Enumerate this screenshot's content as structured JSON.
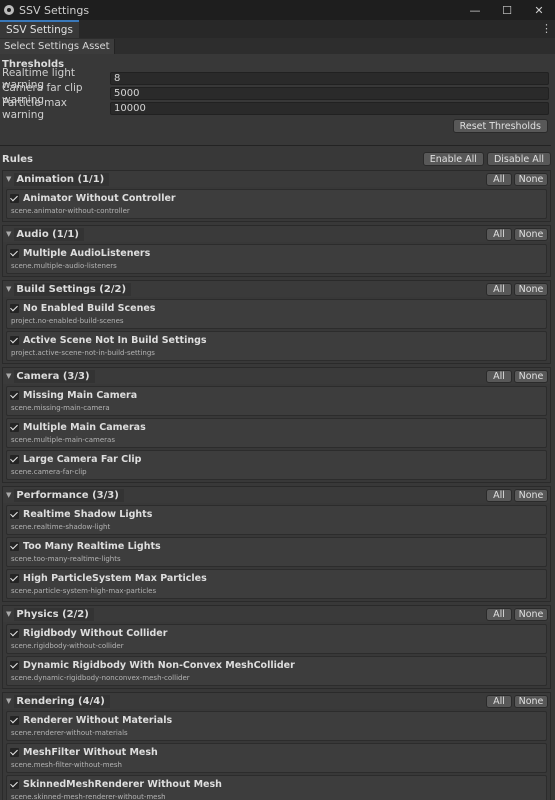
{
  "window": {
    "title": "SSV Settings",
    "minimize": "—",
    "maximize": "☐",
    "close": "✕"
  },
  "tab": {
    "label": "SSV Settings",
    "menu": "⋮"
  },
  "toolbar": {
    "select_label": "Select Settings Asset"
  },
  "thresholds": {
    "title": "Thresholds",
    "fields": [
      {
        "label": "Realtime light warning",
        "value": "8"
      },
      {
        "label": "Camera far clip warning",
        "value": "5000"
      },
      {
        "label": "Particle max warning",
        "value": "10000"
      }
    ],
    "reset_label": "Reset Thresholds"
  },
  "rules": {
    "title": "Rules",
    "enable_all": "Enable All",
    "disable_all": "Disable All",
    "all_label": "All",
    "none_label": "None",
    "groups": [
      {
        "title": "Animation (1/1)",
        "items": [
          {
            "name": "Animator Without Controller",
            "id": "scene.animator-without-controller"
          }
        ]
      },
      {
        "title": "Audio (1/1)",
        "items": [
          {
            "name": "Multiple AudioListeners",
            "id": "scene.multiple-audio-listeners"
          }
        ]
      },
      {
        "title": "Build Settings (2/2)",
        "items": [
          {
            "name": "No Enabled Build Scenes",
            "id": "project.no-enabled-build-scenes"
          },
          {
            "name": "Active Scene Not In Build Settings",
            "id": "project.active-scene-not-in-build-settings"
          }
        ]
      },
      {
        "title": "Camera (3/3)",
        "items": [
          {
            "name": "Missing Main Camera",
            "id": "scene.missing-main-camera"
          },
          {
            "name": "Multiple Main Cameras",
            "id": "scene.multiple-main-cameras"
          },
          {
            "name": "Large Camera Far Clip",
            "id": "scene.camera-far-clip"
          }
        ]
      },
      {
        "title": "Performance (3/3)",
        "items": [
          {
            "name": "Realtime Shadow Lights",
            "id": "scene.realtime-shadow-light"
          },
          {
            "name": "Too Many Realtime Lights",
            "id": "scene.too-many-realtime-lights"
          },
          {
            "name": "High ParticleSystem Max Particles",
            "id": "scene.particle-system-high-max-particles"
          }
        ]
      },
      {
        "title": "Physics (2/2)",
        "items": [
          {
            "name": "Rigidbody Without Collider",
            "id": "scene.rigidbody-without-collider"
          },
          {
            "name": "Dynamic Rigidbody With Non-Convex MeshCollider",
            "id": "scene.dynamic-rigidbody-nonconvex-mesh-collider"
          }
        ]
      },
      {
        "title": "Rendering (4/4)",
        "items": [
          {
            "name": "Renderer Without Materials",
            "id": "scene.renderer-without-materials"
          },
          {
            "name": "MeshFilter Without Mesh",
            "id": "scene.mesh-filter-without-mesh"
          },
          {
            "name": "SkinnedMeshRenderer Without Mesh",
            "id": "scene.skinned-mesh-renderer-without-mesh"
          }
        ]
      }
    ]
  }
}
